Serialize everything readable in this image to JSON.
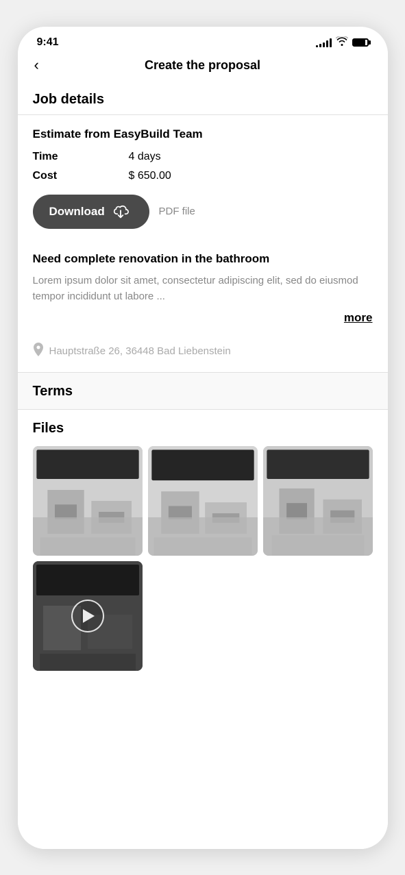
{
  "statusBar": {
    "time": "9:41",
    "signalBars": [
      3,
      5,
      7,
      9,
      11
    ],
    "batteryLevel": 85
  },
  "header": {
    "backLabel": "‹",
    "title": "Create the proposal"
  },
  "jobDetails": {
    "sectionTitle": "Job details",
    "estimate": {
      "heading": "Estimate from EasyBuild Team",
      "timeLabel": "Time",
      "timeValue": "4 days",
      "costLabel": "Cost",
      "costValue": "$ 650.00"
    },
    "downloadBtn": "Download",
    "pdfLabel": "PDF file",
    "descriptionTitle": "Need complete renovation in the bathroom",
    "descriptionText": "Lorem ipsum dolor sit amet, consectetur adipiscing elit, sed do eiusmod tempor incididunt ut labore ...",
    "moreLink": "more",
    "location": "Hauptstraße 26, 36448 Bad Liebenstein"
  },
  "terms": {
    "sectionTitle": "Terms"
  },
  "files": {
    "sectionTitle": "Files",
    "images": [
      {
        "id": 1,
        "alt": "Room image 1"
      },
      {
        "id": 2,
        "alt": "Room image 2"
      },
      {
        "id": 3,
        "alt": "Room image 3"
      }
    ],
    "video": {
      "alt": "Room video",
      "playLabel": "Play"
    }
  }
}
